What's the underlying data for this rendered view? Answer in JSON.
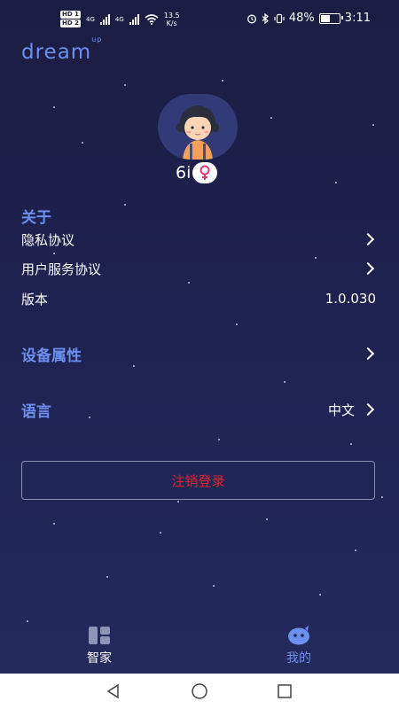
{
  "status_bar": {
    "hd1": "HD 1",
    "hd2": "HD 2",
    "net1": "4G",
    "net2": "4G",
    "speed_value": "13.5",
    "speed_unit": "K/s",
    "battery_percent": "48%",
    "battery_level": 0.48,
    "time": "3:11",
    "icons": [
      "alarm-icon",
      "bluetooth-icon",
      "vibrate-icon"
    ]
  },
  "logo": {
    "text": "dream",
    "superscript": "up"
  },
  "profile": {
    "username": "6i",
    "gender_icon": "female-symbol-icon"
  },
  "about": {
    "title": "关于",
    "privacy_label": "隐私协议",
    "terms_label": "用户服务协议",
    "version_label": "版本",
    "version_value": "1.0.030"
  },
  "device": {
    "title": "设备属性"
  },
  "language": {
    "title": "语言",
    "value": "中文"
  },
  "logout_label": "注销登录",
  "tabs": [
    {
      "label": "智家",
      "icon": "smart-home-grid-icon",
      "active": false
    },
    {
      "label": "我的",
      "icon": "mascot-face-icon",
      "active": true
    }
  ],
  "colors": {
    "accent": "#6e8ff0",
    "danger": "#e0242f",
    "background": "#1e2250"
  },
  "nav_bar": {
    "icons": [
      "back-triangle-icon",
      "home-circle-icon",
      "recents-square-icon"
    ]
  }
}
